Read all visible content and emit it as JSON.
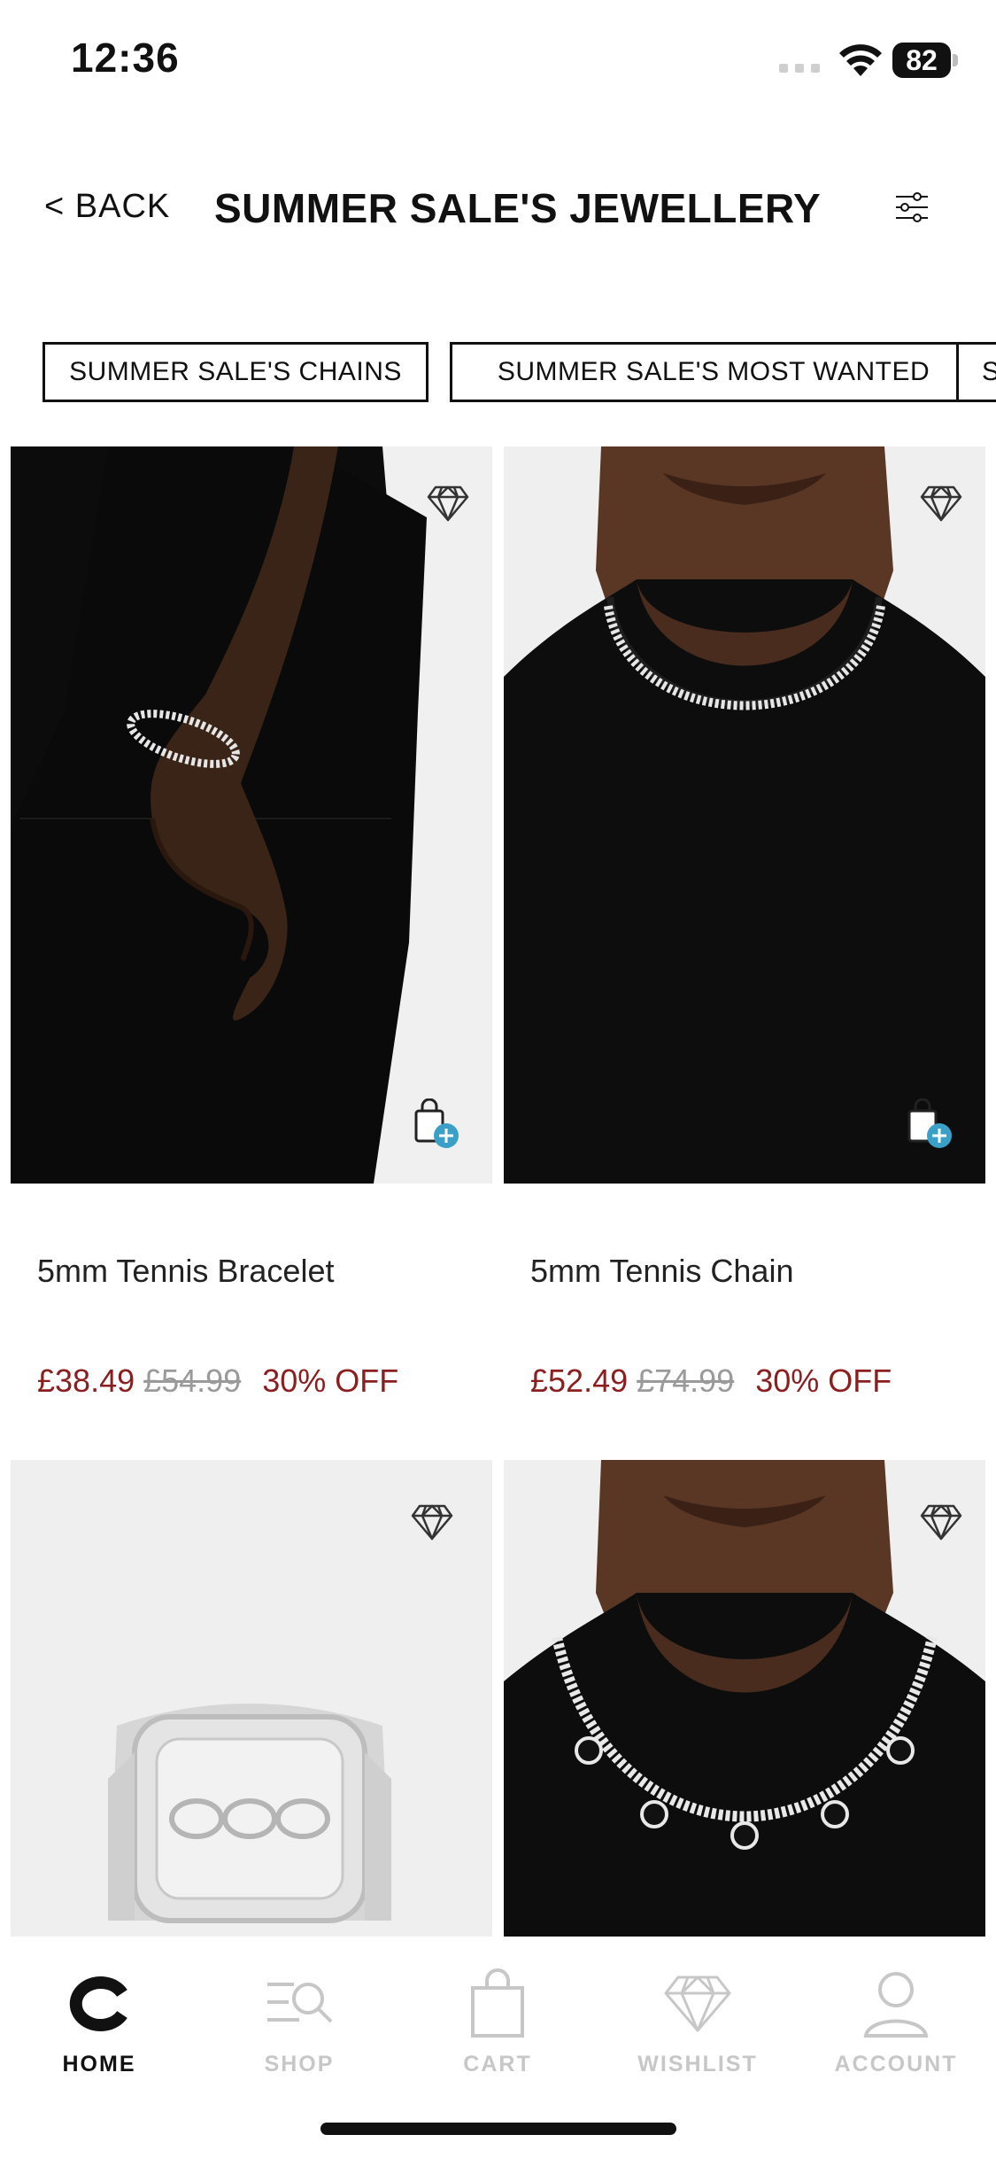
{
  "status": {
    "time": "12:36",
    "battery": "82"
  },
  "header": {
    "back_label": "< BACK",
    "title": "SUMMER SALE'S JEWELLERY"
  },
  "chips": [
    "SUMMER SALE'S CHAINS",
    "SUMMER SALE'S MOST WANTED",
    "S"
  ],
  "products": [
    {
      "name": "5mm Tennis Bracelet",
      "price": "£38.49",
      "was": "£54.99",
      "discount": "30% OFF"
    },
    {
      "name": "5mm Tennis Chain",
      "price": "£52.49",
      "was": "£74.99",
      "discount": "30% OFF"
    },
    {
      "name": "",
      "price": "",
      "was": "",
      "discount": ""
    },
    {
      "name": "",
      "price": "",
      "was": "",
      "discount": ""
    }
  ],
  "tabs": [
    {
      "label": "HOME",
      "icon": "home-logo-icon",
      "active": true
    },
    {
      "label": "SHOP",
      "icon": "shop-search-icon",
      "active": false
    },
    {
      "label": "CART",
      "icon": "cart-bag-icon",
      "active": false
    },
    {
      "label": "WISHLIST",
      "icon": "diamond-icon",
      "active": false
    },
    {
      "label": "ACCOUNT",
      "icon": "account-icon",
      "active": false
    }
  ],
  "colors": {
    "sale_red": "#8b1e1e",
    "accent_blue": "#3aa0c8",
    "tab_inactive": "#c7c7c7"
  }
}
